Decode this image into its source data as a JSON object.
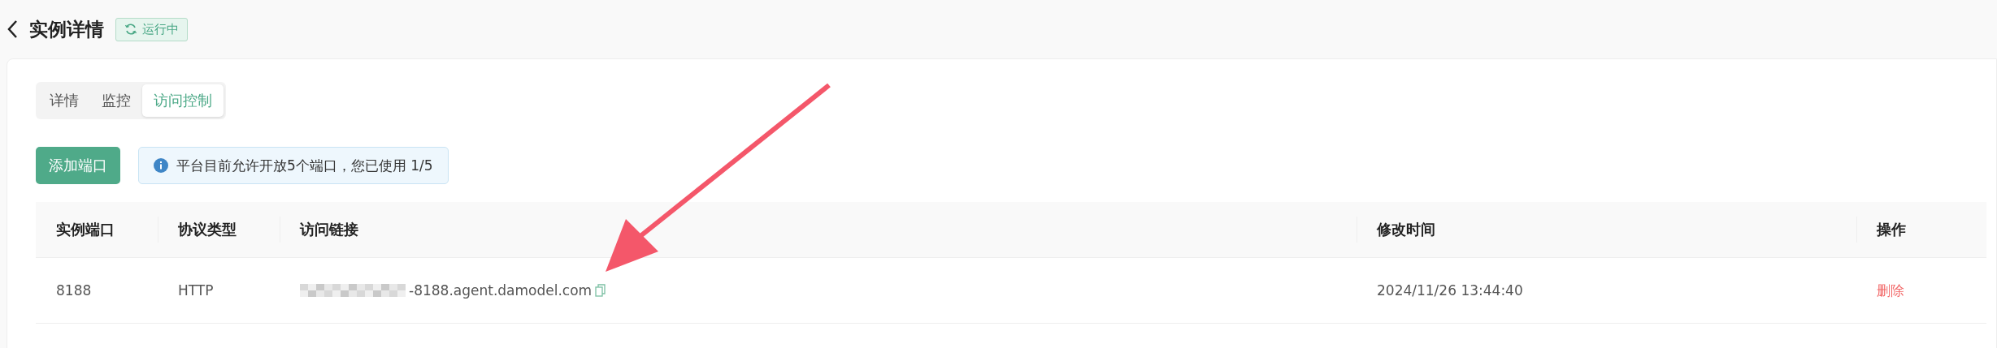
{
  "header": {
    "title": "实例详情",
    "status": {
      "label": "运行中",
      "kind": "running"
    }
  },
  "tabs": [
    {
      "label": "详情",
      "selected": false
    },
    {
      "label": "监控",
      "selected": false
    },
    {
      "label": "访问控制",
      "selected": true
    }
  ],
  "add_button": "添加端口",
  "info": "平台目前允许开放5个端口，您已使用 1/5",
  "table": {
    "columns": [
      "实例端口",
      "协议类型",
      "访问链接",
      "修改时间",
      "操作"
    ],
    "rows": [
      {
        "port": "8188",
        "protocol": "HTTP",
        "link": "-8188.agent.damodel.com",
        "link_redacted": true,
        "modified": "2024/11/26 13:44:40",
        "action": "删除"
      }
    ]
  },
  "annotation": {
    "kind": "arrow"
  }
}
